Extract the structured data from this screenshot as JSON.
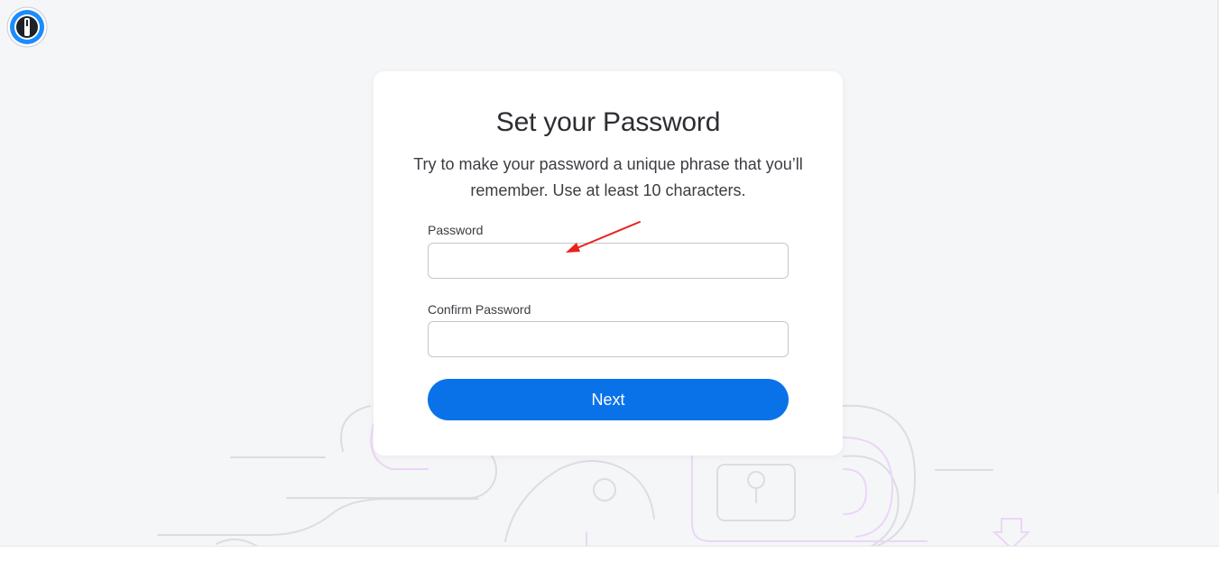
{
  "brand": {
    "logo_icon": "1password-logo-icon",
    "accent_color": "#0a72e9"
  },
  "form": {
    "title": "Set your Password",
    "subtitle": "Try to make your password a unique phrase that you’ll remember. Use at least 10 characters.",
    "password_label": "Password",
    "password_value": "",
    "confirm_label": "Confirm Password",
    "confirm_value": "",
    "next_label": "Next"
  },
  "annotation": {
    "arrow_icon": "red-arrow-icon",
    "arrow_color": "#e8211b"
  }
}
